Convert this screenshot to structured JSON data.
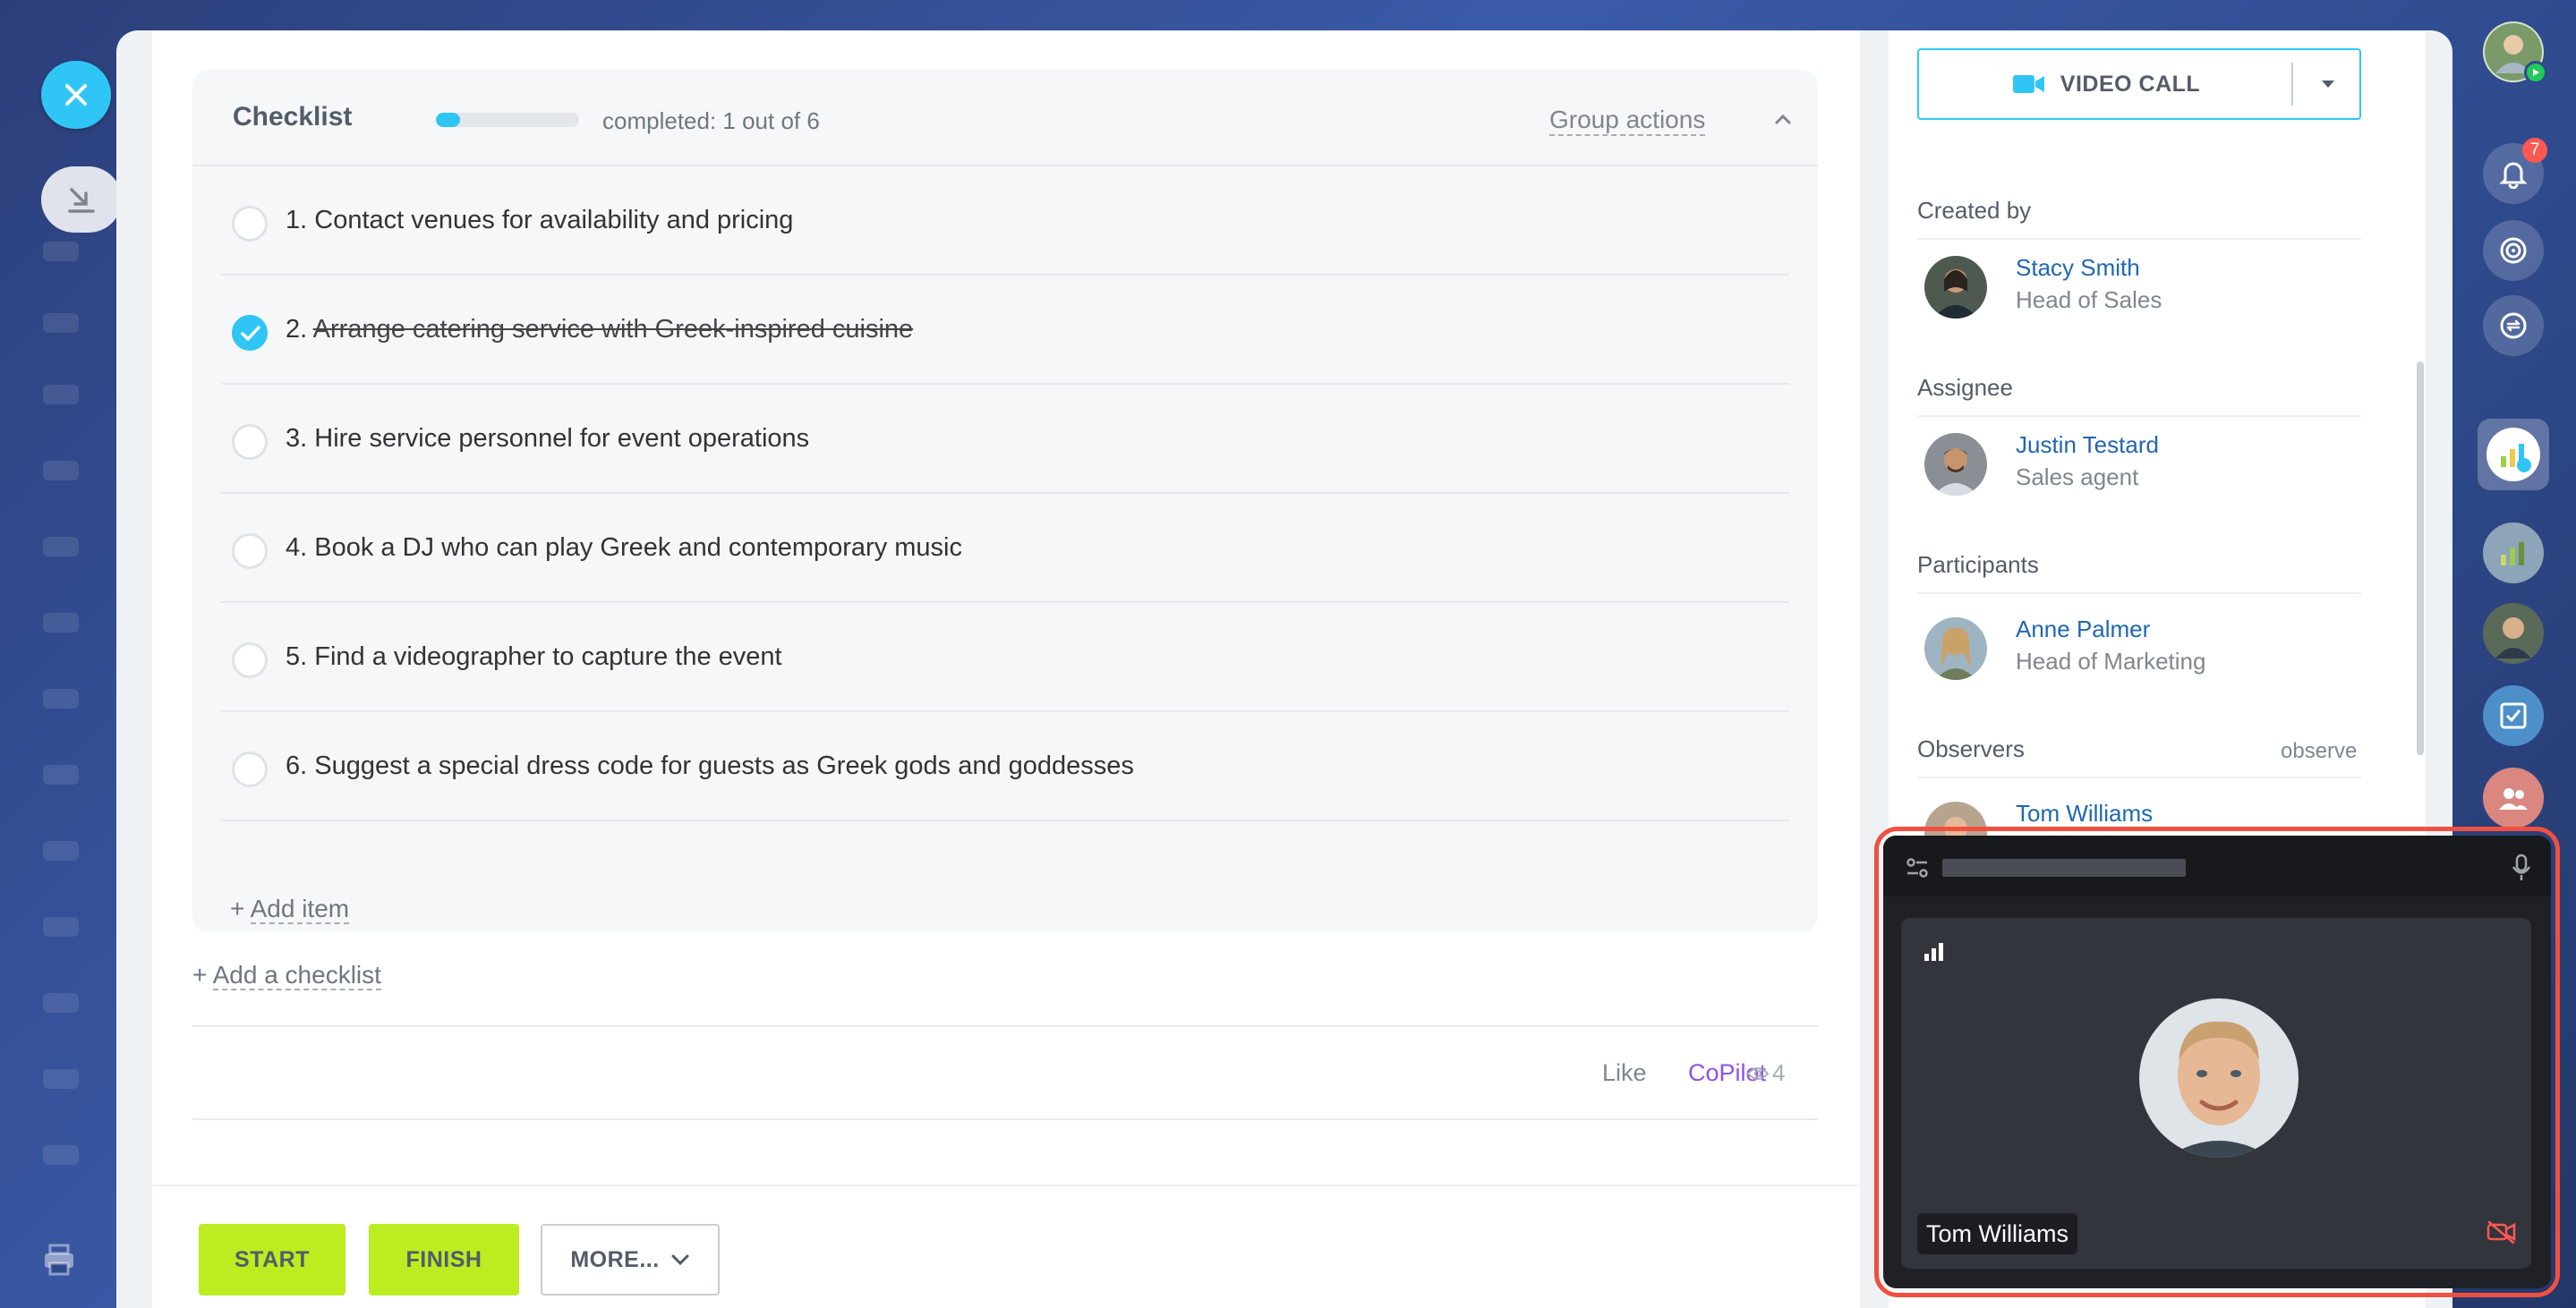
{
  "checklist": {
    "title": "Checklist",
    "progress_fraction": 0.17,
    "completed_text": "completed: 1 out of 6",
    "group_actions_label": "Group actions",
    "items": [
      {
        "number": "1.",
        "text": "Contact venues for availability and pricing",
        "done": false
      },
      {
        "number": "2.",
        "text": "Arrange catering service with Greek-inspired cuisine",
        "done": true
      },
      {
        "number": "3.",
        "text": "Hire service personnel for event operations",
        "done": false
      },
      {
        "number": "4.",
        "text": "Book a DJ who can play Greek and contemporary music",
        "done": false
      },
      {
        "number": "5.",
        "text": "Find a videographer to capture the event",
        "done": false
      },
      {
        "number": "6.",
        "text": "Suggest a special dress code for guests as Greek gods and goddesses",
        "done": false
      }
    ],
    "add_item_prefix": "+",
    "add_item_label": "Add item"
  },
  "add_checklist": {
    "prefix": "+",
    "label": "Add a checklist"
  },
  "feedback": {
    "like_label": "Like",
    "copilot_label": "CoPilot",
    "views_count": "4"
  },
  "footer": {
    "start_label": "START",
    "finish_label": "FINISH",
    "more_label": "MORE..."
  },
  "sidebar": {
    "video_call_label": "VIDEO CALL",
    "created_by": {
      "title": "Created by",
      "name": "Stacy Smith",
      "role": "Head of Sales"
    },
    "assignee": {
      "title": "Assignee",
      "name": "Justin Testard",
      "role": "Sales agent"
    },
    "participants": {
      "title": "Participants",
      "name": "Anne Palmer",
      "role": "Head of Marketing"
    },
    "observers": {
      "title": "Observers",
      "observe_label": "observe",
      "name": "Tom Williams"
    }
  },
  "call": {
    "participant_name": "Tom Williams"
  },
  "notifications": {
    "count": "7"
  },
  "colors": {
    "accent": "#2fc6f6",
    "green_button": "#bbed21",
    "link": "#2067b0",
    "copilot": "#8e52ec",
    "highlight_frame": "#f0503f"
  }
}
